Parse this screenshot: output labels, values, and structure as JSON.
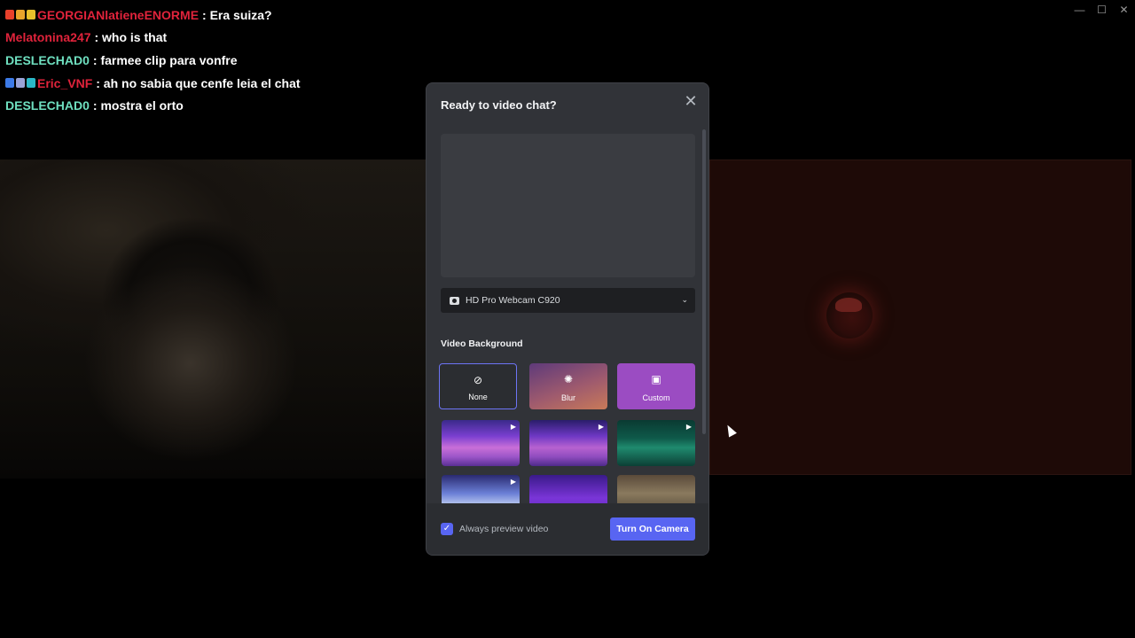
{
  "window": {
    "minimize": "—",
    "maximize": "☐",
    "close": "✕"
  },
  "chat": [
    {
      "user": "GEORGIANlatieneENORME",
      "color": "#e0233b",
      "message": ": Era suiza?",
      "badges": [
        "#e8402b",
        "#e8a42b",
        "#e8c02b"
      ]
    },
    {
      "user": "Melatonina247",
      "color": "#e0233b",
      "message": ": who is that",
      "badges": []
    },
    {
      "user": "DESLECHAD0",
      "color": "#6fe0c0",
      "message": ": farmee clip para vonfre",
      "badges": []
    },
    {
      "user": "Eric_VNF",
      "color": "#e0233b",
      "message": ": ah no sabia que cenfe leia el chat",
      "badges": [
        "#3d7be8",
        "#9aa4d8",
        "#2bb8c8"
      ]
    },
    {
      "user": "DESLECHAD0",
      "color": "#6fe0c0",
      "message": ": mostra el orto",
      "badges": []
    }
  ],
  "modal": {
    "title": "Ready to video chat?",
    "close_icon": "✕",
    "device": "HD Pro Webcam C920",
    "section_label": "Video Background",
    "backgrounds": {
      "none": {
        "label": "None",
        "icon": "⊘"
      },
      "blur": {
        "label": "Blur",
        "icon": "✺"
      },
      "custom": {
        "label": "Custom",
        "icon": "▣"
      }
    },
    "play_icon": "▶",
    "always_preview_label": "Always preview video",
    "always_preview_checked": true,
    "check_icon": "✓",
    "turn_on_button": "Turn On Camera"
  },
  "colors": {
    "accent": "#5865f2",
    "modal_bg": "#313338",
    "footer_bg": "#2b2d31"
  }
}
